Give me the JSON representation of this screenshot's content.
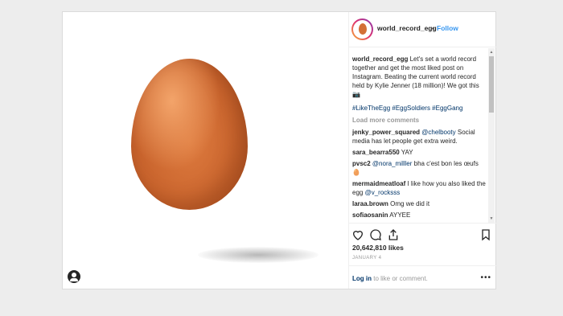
{
  "post": {
    "username": "world_record_egg",
    "follow_label": "Follow",
    "separator": "•",
    "caption_text": "Let's set a world record together and get the most liked post on Instagram. Beating the current world record held by Kylie Jenner (18 million)! We got this 📷",
    "hashtags": "#LikeTheEgg #EggSoldiers #EggGang",
    "load_more": "Load more comments",
    "likes": "20,642,810 likes",
    "date": "JANUARY 4",
    "login_link": "Log in",
    "login_rest": " to like or comment.",
    "more_dots": "•••"
  },
  "comments": [
    {
      "user": "jenky_power_squared",
      "mention": "@chelbooty",
      "text": " Social media has let people get extra weird."
    },
    {
      "user": "sara_bearra550",
      "mention": "",
      "text": "YAY"
    },
    {
      "user": "pvsc2",
      "mention": "@nora_milller",
      "text": " bha c'est bon les œufs 🥚"
    },
    {
      "user": "mermaidmeatloaf",
      "mention": "",
      "text": "I like how you also liked the egg "
    },
    {
      "user": "laraa.brown",
      "mention": "",
      "text": "Omg we did it"
    },
    {
      "user": "sofiaosanin",
      "mention": "",
      "text": "AYYEE"
    }
  ],
  "comment4_mention": "@v_rocksss",
  "icons": [
    "heart-icon",
    "comment-icon",
    "share-icon",
    "bookmark-icon",
    "user-icon"
  ],
  "colors": {
    "link": "#3897f0",
    "egg": "#d36f36",
    "background": "#ededed"
  }
}
